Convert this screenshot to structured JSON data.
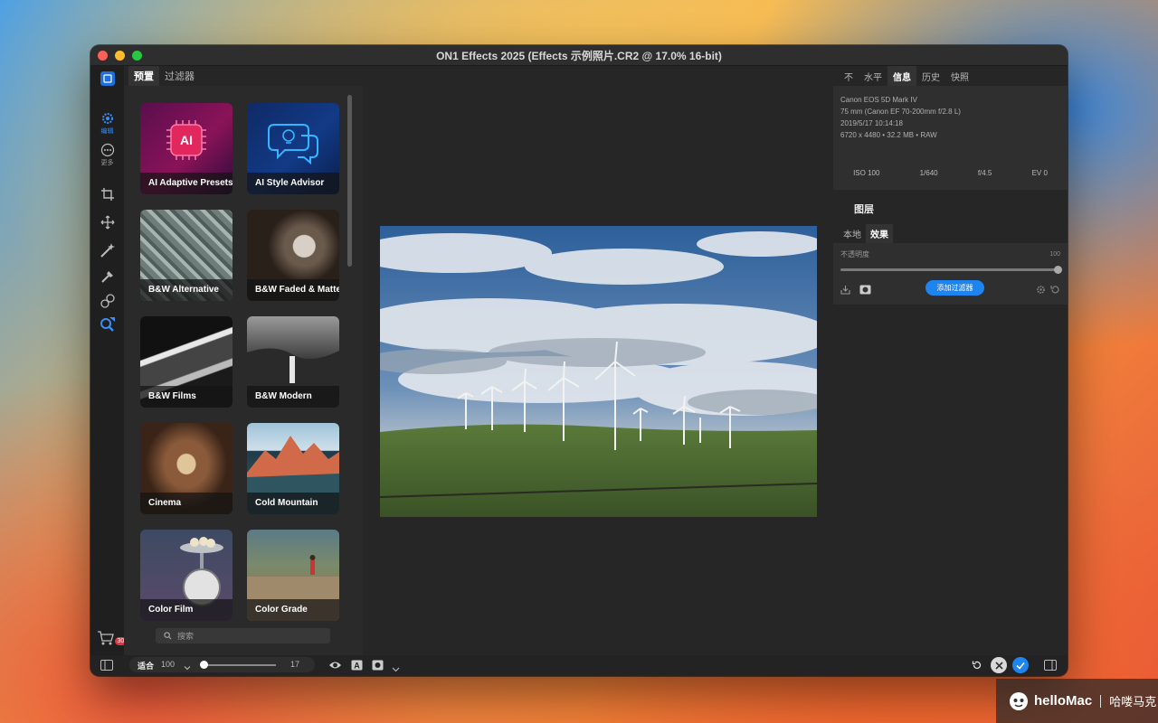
{
  "window": {
    "title": "ON1 Effects 2025 (Effects 示例照片.CR2 @ 17.0% 16-bit)"
  },
  "rail": {
    "edit_label": "编辑",
    "more_label": "更多",
    "cart_badge": "30"
  },
  "browser": {
    "tabs": [
      {
        "label": "预置",
        "active": true
      },
      {
        "label": "过滤器",
        "active": false
      }
    ],
    "presets": [
      {
        "label": "AI Adaptive Presets"
      },
      {
        "label": "AI Style Advisor"
      },
      {
        "label": "B&W Alternative"
      },
      {
        "label": "B&W Faded & Matte"
      },
      {
        "label": "B&W Films"
      },
      {
        "label": "B&W Modern"
      },
      {
        "label": "Cinema"
      },
      {
        "label": "Cold Mountain"
      },
      {
        "label": "Color Film"
      },
      {
        "label": "Color Grade"
      }
    ],
    "search_placeholder": "搜索"
  },
  "right": {
    "tabs": [
      {
        "label": "不",
        "active": false
      },
      {
        "label": "水平",
        "active": false
      },
      {
        "label": "信息",
        "active": true
      },
      {
        "label": "历史",
        "active": false
      },
      {
        "label": "快照",
        "active": false
      }
    ],
    "info": {
      "camera": "Canon EOS 5D Mark IV",
      "lens": "75 mm (Canon EF 70-200mm f/2.8 L)",
      "datetime": "2019/5/17  10:14:18",
      "dimensions": "6720 x 4480 • 32.2 MB • RAW",
      "iso": "ISO 100",
      "shutter": "1/640",
      "aperture": "f/4.5",
      "ev": "EV 0"
    },
    "layers_title": "图层",
    "layer_tabs": [
      {
        "label": "本地",
        "active": false
      },
      {
        "label": "效果",
        "active": true
      }
    ],
    "opacity_label": "不透明度",
    "opacity_value": "100",
    "add_filter_label": "添加过滤器"
  },
  "bottombar": {
    "fit_label": "适合",
    "fit_value": "100",
    "zoom_value": "17"
  },
  "watermark": {
    "brand": "helloMac",
    "cn": "哈喽马克"
  },
  "colors": {
    "accent": "#1e84f0",
    "badge": "#e8303f"
  }
}
